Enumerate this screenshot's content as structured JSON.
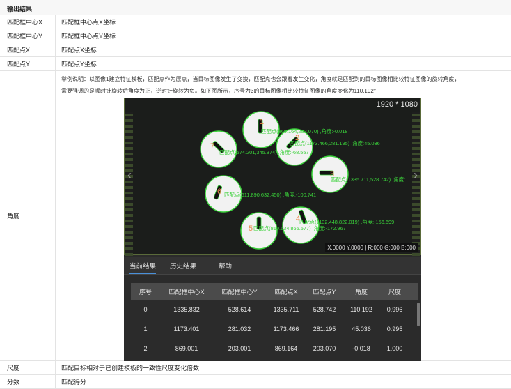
{
  "header": {
    "title": "输出结果"
  },
  "rows": [
    {
      "name": "匹配框中心X",
      "desc": "匹配框中心点X坐标"
    },
    {
      "name": "匹配框中心Y",
      "desc": "匹配框中心点Y坐标"
    },
    {
      "name": "匹配点X",
      "desc": "匹配点X坐标"
    },
    {
      "name": "匹配点Y",
      "desc": "匹配点Y坐标"
    }
  ],
  "angle": {
    "name": "角度",
    "line1": "举例说明：以图像1建立特征模板，匹配点作为原点，当目标图像发生了变换，匹配点也会跟着发生变化，角度就是匹配到的目标图像相比较特征图像的旋转角度，",
    "line2": "需要强调的是顺时针旋转后角度为正，逆时针旋转为负。如下图所示，序号为3的目标图像相比较特征图像的角度变化为110.192°"
  },
  "screenshot": {
    "resolution": "1920 * 1080",
    "status": "X,0000  Y,0000  |  R:000  G:000  B:000",
    "arrow_left": "‹",
    "arrow_right": "›",
    "matches": [
      {
        "num": "1",
        "label": "匹配点(869.164,203.070) ,角度:-0.018"
      },
      {
        "num": "2",
        "label": "匹配点(1173.466,281.195) ,角度:45.036"
      },
      {
        "num": "3",
        "label": "匹配点(1335.711,528.742) ,角度:"
      },
      {
        "num": "4",
        "label": "匹配点(1132.448,822.019) ,角度:-156.699"
      },
      {
        "num": "5",
        "label": "匹配点(810.634,865.577) ,角度:-172.967"
      },
      {
        "num": "6",
        "label": "匹配点(611.890,632.450) ,角度:-100.741"
      },
      {
        "num": "7",
        "label": "匹配点(574.201,345.374) ,角度:-68.557"
      }
    ],
    "tabs": [
      "当前结果",
      "历史结果",
      "帮助"
    ],
    "table": {
      "headers": [
        "序号",
        "匹配框中心X",
        "匹配框中心Y",
        "匹配点X",
        "匹配点Y",
        "角度",
        "尺度"
      ],
      "rows": [
        [
          "0",
          "1335.832",
          "528.614",
          "1335.711",
          "528.742",
          "110.192",
          "0.996"
        ],
        [
          "1",
          "1173.401",
          "281.032",
          "1173.466",
          "281.195",
          "45.036",
          "0.995"
        ],
        [
          "2",
          "869.001",
          "203.001",
          "869.164",
          "203.070",
          "-0.018",
          "1.000"
        ]
      ]
    }
  },
  "footer_rows": [
    {
      "name": "尺度",
      "desc": "匹配目标相对于已创建模板的一致性尺度变化倍数"
    },
    {
      "name": "分数",
      "desc": "匹配得分"
    }
  ],
  "colors": {
    "match_green": "#3ad13a",
    "number_orange": "#e8884a",
    "tab_accent": "#4a90d9"
  }
}
